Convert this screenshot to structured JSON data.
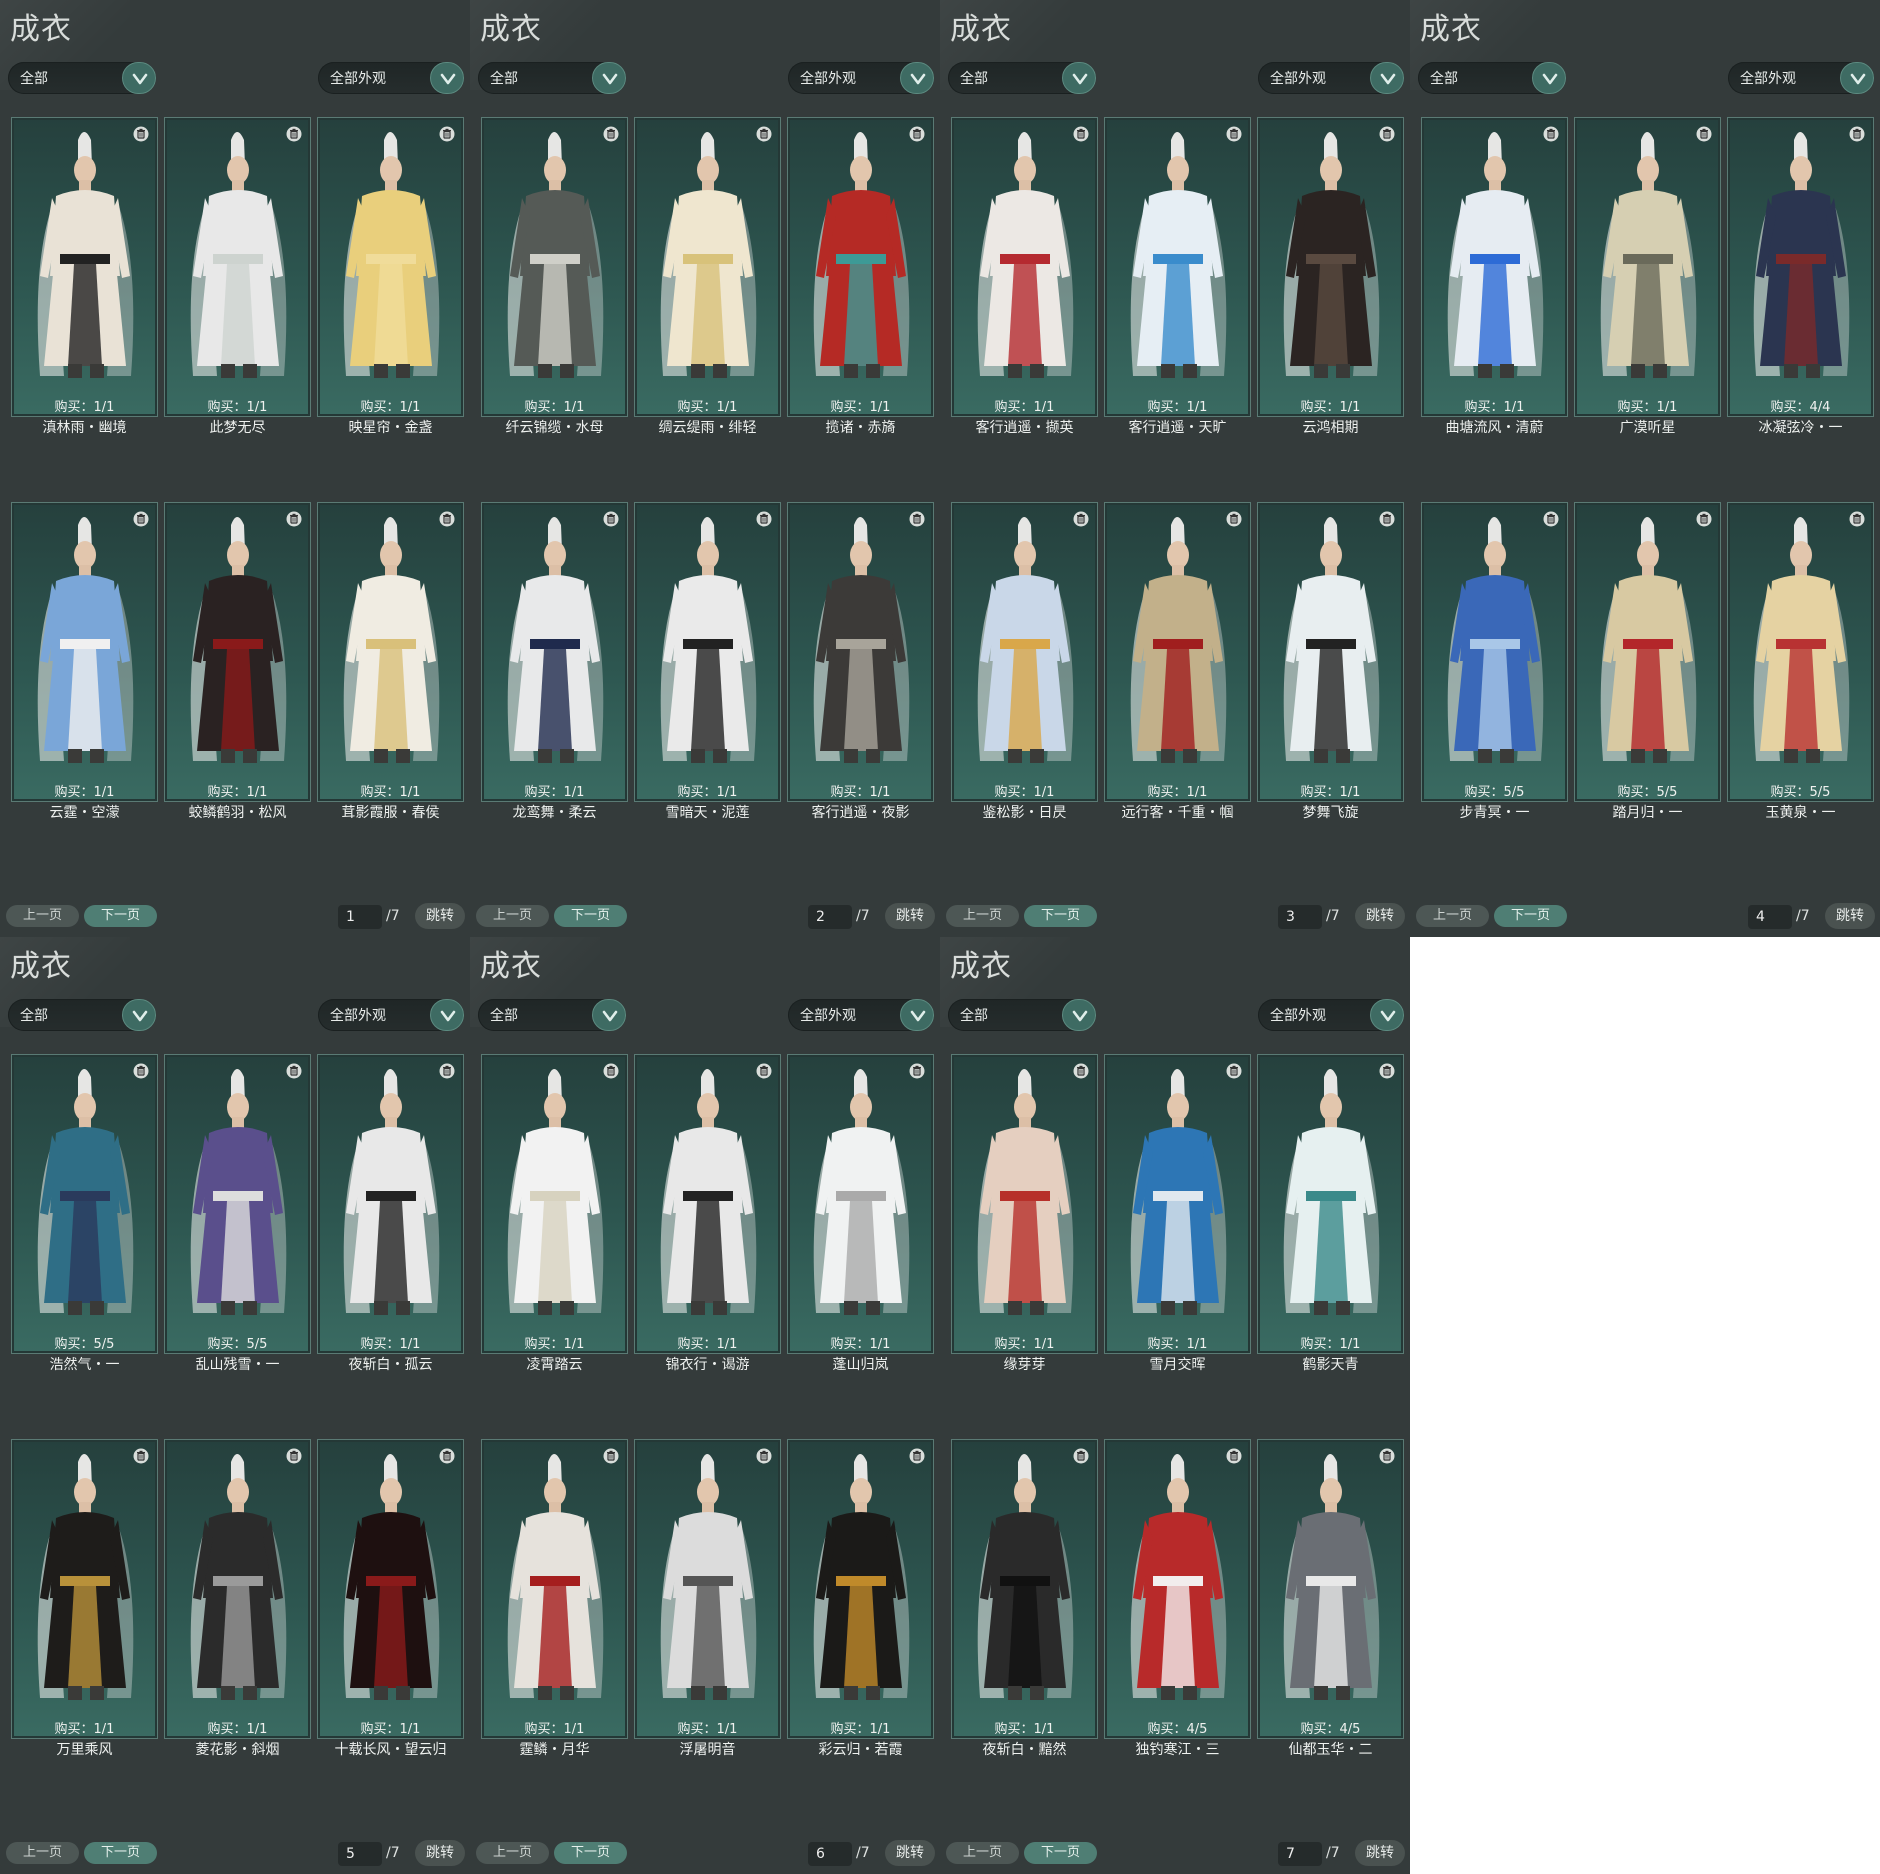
{
  "panel_title": "成衣",
  "filter_category": "全部",
  "filter_appearance": "全部外观",
  "prev_label": "上一页",
  "next_label": "下一页",
  "jump_label": "跳转",
  "total_pages": "/7",
  "icons": {
    "dropdown": "chevron-down-icon",
    "trash": "trash-icon"
  },
  "colors": {
    "panel_bg": "#343b3b",
    "card_bg": "#2d5650",
    "accent": "#4f7e74"
  },
  "pages": [
    {
      "page": "1",
      "items": [
        {
          "name": "滇林雨・幽境",
          "buy": "购买：1/1"
        },
        {
          "name": "此梦无尽",
          "buy": "购买：1/1"
        },
        {
          "name": "映星帘・金盏",
          "buy": "购买：1/1"
        },
        {
          "name": "云霆・空濛",
          "buy": "购买：1/1"
        },
        {
          "name": "蛟鳞鹤羽・松风",
          "buy": "购买：1/1"
        },
        {
          "name": "茸影霞服・春侯",
          "buy": "购买：1/1"
        }
      ]
    },
    {
      "page": "2",
      "items": [
        {
          "name": "纤云锦缆・水母",
          "buy": "购买：1/1"
        },
        {
          "name": "绸云缇雨・绯轻",
          "buy": "购买：1/1"
        },
        {
          "name": "揽诸・赤旖",
          "buy": "购买：1/1"
        },
        {
          "name": "龙鸾舞・柔云",
          "buy": "购买：1/1"
        },
        {
          "name": "雪暗天・泥莲",
          "buy": "购买：1/1"
        },
        {
          "name": "客行逍遥・夜影",
          "buy": "购买：1/1"
        }
      ]
    },
    {
      "page": "3",
      "items": [
        {
          "name": "客行逍遥・撷英",
          "buy": "购买：1/1"
        },
        {
          "name": "客行逍遥・天旷",
          "buy": "购买：1/1"
        },
        {
          "name": "云鸿相期",
          "buy": "购买：1/1"
        },
        {
          "name": "鉴松影・日昃",
          "buy": "购买：1/1"
        },
        {
          "name": "远行客・千重・帼",
          "buy": "购买：1/1"
        },
        {
          "name": "梦舞飞旋",
          "buy": "购买：1/1"
        }
      ]
    },
    {
      "page": "4",
      "items": [
        {
          "name": "曲塘流风・清蔚",
          "buy": "购买：1/1"
        },
        {
          "name": "广漠听星",
          "buy": "购买：1/1"
        },
        {
          "name": "冰凝弦冷・一",
          "buy": "购买：4/4"
        },
        {
          "name": "步青冥・一",
          "buy": "购买：5/5"
        },
        {
          "name": "踏月归・一",
          "buy": "购买：5/5"
        },
        {
          "name": "玉黄泉・一",
          "buy": "购买：5/5"
        }
      ]
    },
    {
      "page": "5",
      "items": [
        {
          "name": "浩然气・一",
          "buy": "购买：5/5"
        },
        {
          "name": "乱山残雪・一",
          "buy": "购买：5/5"
        },
        {
          "name": "夜斩白・孤云",
          "buy": "购买：1/1"
        },
        {
          "name": "万里乘风",
          "buy": "购买：1/1"
        },
        {
          "name": "菱花影・斜烟",
          "buy": "购买：1/1"
        },
        {
          "name": "十载长风・望云归",
          "buy": "购买：1/1"
        }
      ]
    },
    {
      "page": "6",
      "items": [
        {
          "name": "凌霄踏云",
          "buy": "购买：1/1"
        },
        {
          "name": "锦衣行・谒游",
          "buy": "购买：1/1"
        },
        {
          "name": "蓬山归岚",
          "buy": "购买：1/1"
        },
        {
          "name": "霆鳞・月华",
          "buy": "购买：1/1"
        },
        {
          "name": "浮屠明音",
          "buy": "购买：1/1"
        },
        {
          "name": "彩云归・若霞",
          "buy": "购买：1/1"
        }
      ]
    },
    {
      "page": "7",
      "items": [
        {
          "name": "缘芽芽",
          "buy": "购买：1/1"
        },
        {
          "name": "雪月交晖",
          "buy": "购买：1/1"
        },
        {
          "name": "鹤影天青",
          "buy": "购买：1/1"
        },
        {
          "name": "夜斩白・黯然",
          "buy": "购买：1/1"
        },
        {
          "name": "独钓寒江・三",
          "buy": "购买：4/5"
        },
        {
          "name": "仙都玉华・二",
          "buy": "购买：4/5"
        }
      ]
    }
  ]
}
